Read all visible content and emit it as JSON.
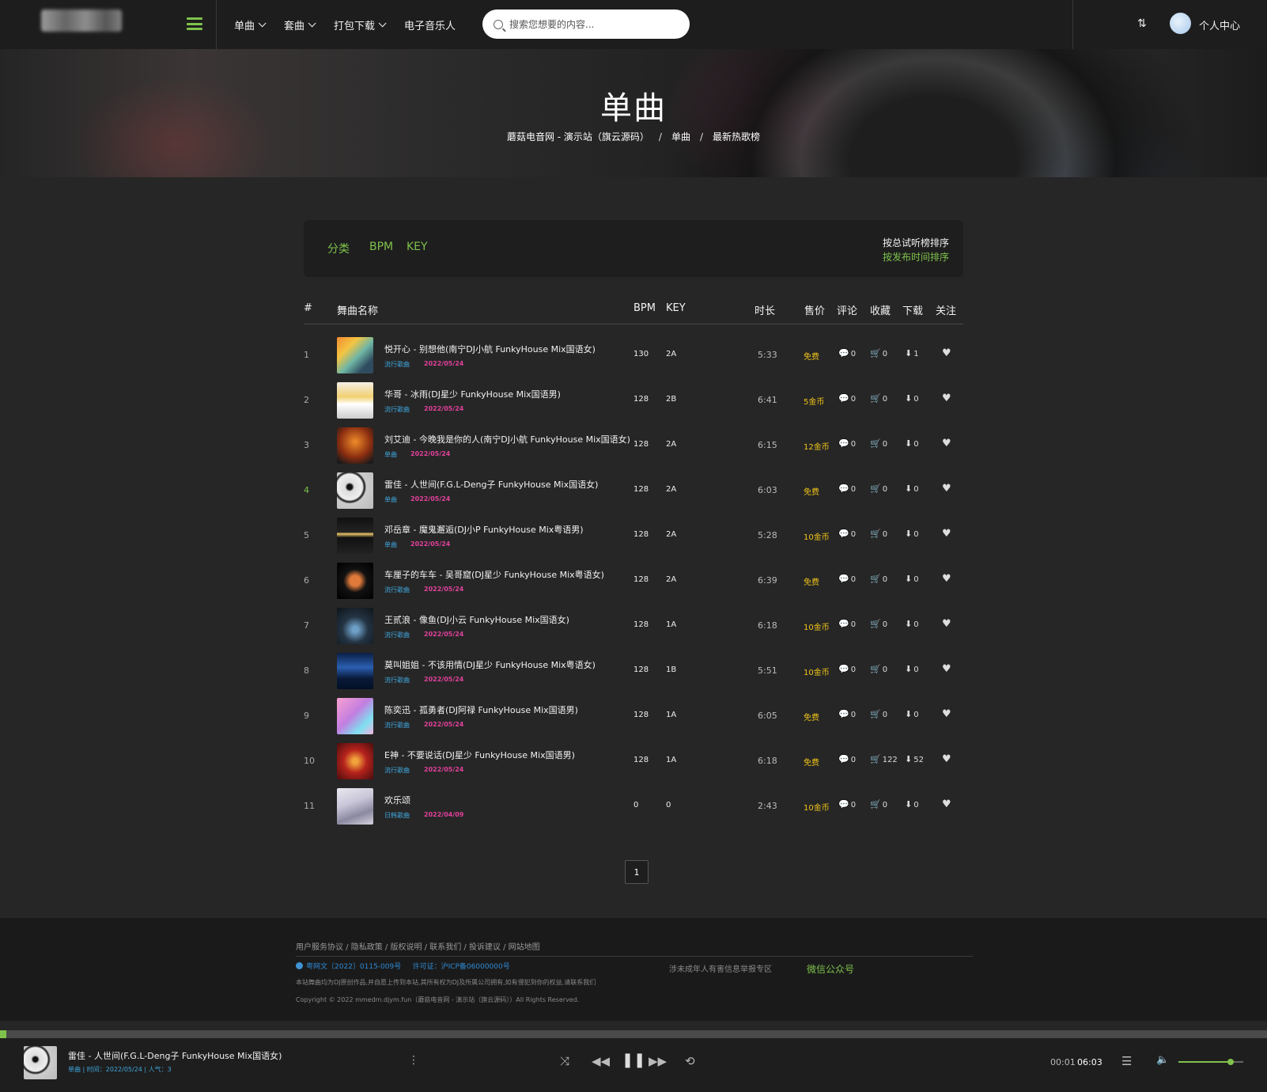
{
  "header": {
    "nav": [
      {
        "label": "单曲",
        "dropdown": true
      },
      {
        "label": "套曲",
        "dropdown": true
      },
      {
        "label": "打包下载",
        "dropdown": true
      },
      {
        "label": "电子音乐人",
        "dropdown": false
      }
    ],
    "search_placeholder": "搜索您想要的内容...",
    "user_center": "个人中心"
  },
  "banner": {
    "title": "单曲",
    "breadcrumb": [
      "蘑菇电音网 - 演示站（旗云源码）",
      "单曲",
      "最新热歌榜"
    ]
  },
  "filter": {
    "tabs": [
      "分类",
      "BPM",
      "KEY"
    ],
    "sort_primary": "按总试听榜排序",
    "sort_secondary": "按发布时间排序"
  },
  "table": {
    "headers": {
      "index": "#",
      "name": "舞曲名称",
      "bpm": "BPM",
      "key": "KEY",
      "duration": "时长",
      "price": "售价",
      "comments": "评论",
      "favorites": "收藏",
      "downloads": "下载",
      "follow": "关注"
    },
    "rows": [
      {
        "index": "1",
        "title": "悦开心 - 别想他(南宁DJ小航 FunkyHouse Mix国语女)",
        "category": "流行歌曲",
        "date": "2022/05/24",
        "bpm": "130",
        "key": "2A",
        "duration": "5:33",
        "price": "免费",
        "comments": "0",
        "favorites": "0",
        "downloads": "1"
      },
      {
        "index": "2",
        "title": "华哥 - 冰雨(DJ星少 FunkyHouse Mix国语男)",
        "category": "流行歌曲",
        "date": "2022/05/24",
        "bpm": "128",
        "key": "2B",
        "duration": "6:41",
        "price": "5金币",
        "comments": "0",
        "favorites": "0",
        "downloads": "0"
      },
      {
        "index": "3",
        "title": "刘艾迪 - 今晚我是你的人(南宁DJ小航 FunkyHouse Mix国语女)",
        "category": "单曲",
        "date": "2022/05/24",
        "bpm": "128",
        "key": "2A",
        "duration": "6:15",
        "price": "12金币",
        "comments": "0",
        "favorites": "0",
        "downloads": "0"
      },
      {
        "index": "4",
        "title": "雷佳 - 人世间(F.G.L-Deng子 FunkyHouse Mix国语女)",
        "category": "单曲",
        "date": "2022/05/24",
        "bpm": "128",
        "key": "2A",
        "duration": "6:03",
        "price": "免费",
        "comments": "0",
        "favorites": "0",
        "downloads": "0"
      },
      {
        "index": "5",
        "title": "邓岳章 - 魔鬼邂逅(DJ小P FunkyHouse Mix粤语男)",
        "category": "单曲",
        "date": "2022/05/24",
        "bpm": "128",
        "key": "2A",
        "duration": "5:28",
        "price": "10金币",
        "comments": "0",
        "favorites": "0",
        "downloads": "0"
      },
      {
        "index": "6",
        "title": "车厘子的车车 - 吴哥窟(DJ星少 FunkyHouse Mix粤语女)",
        "category": "流行歌曲",
        "date": "2022/05/24",
        "bpm": "128",
        "key": "2A",
        "duration": "6:39",
        "price": "免费",
        "comments": "0",
        "favorites": "0",
        "downloads": "0"
      },
      {
        "index": "7",
        "title": "王贰浪 - 像鱼(DJ小云 FunkyHouse Mix国语女)",
        "category": "流行歌曲",
        "date": "2022/05/24",
        "bpm": "128",
        "key": "1A",
        "duration": "6:18",
        "price": "10金币",
        "comments": "0",
        "favorites": "0",
        "downloads": "0"
      },
      {
        "index": "8",
        "title": "莫叫姐姐 - 不该用情(DJ星少 FunkyHouse Mix粤语女)",
        "category": "流行歌曲",
        "date": "2022/05/24",
        "bpm": "128",
        "key": "1B",
        "duration": "5:51",
        "price": "10金币",
        "comments": "0",
        "favorites": "0",
        "downloads": "0"
      },
      {
        "index": "9",
        "title": "陈奕迅 - 孤勇者(DJ阿禄 FunkyHouse Mix国语男)",
        "category": "流行歌曲",
        "date": "2022/05/24",
        "bpm": "128",
        "key": "1A",
        "duration": "6:05",
        "price": "免费",
        "comments": "0",
        "favorites": "0",
        "downloads": "0"
      },
      {
        "index": "10",
        "title": "E神 - 不要说话(DJ星少 FunkyHouse Mix国语男)",
        "category": "流行歌曲",
        "date": "2022/05/24",
        "bpm": "128",
        "key": "1A",
        "duration": "6:18",
        "price": "免费",
        "comments": "0",
        "favorites": "122",
        "downloads": "52"
      },
      {
        "index": "11",
        "title": "欢乐颂",
        "category": "日韩歌曲",
        "date": "2022/04/09",
        "bpm": "0",
        "key": "0",
        "duration": "2:43",
        "price": "10金币",
        "comments": "0",
        "favorites": "0",
        "downloads": "0"
      }
    ],
    "active_index": 4
  },
  "pagination": {
    "current": "1"
  },
  "footer": {
    "links": [
      "用户服务协议",
      "隐私政策",
      "版权说明",
      "联系我们",
      "投诉建议",
      "网站地图"
    ],
    "icp": "粤网文〔2022〕0115-009号",
    "license": "许可证：沪ICP备06000000号",
    "minor_report": "涉未成年人有害信息举报专区",
    "wechat": "微信公众号",
    "disclaimer": "本站舞曲均为DJ原创作品,并自愿上传到本站,其所有权为DJ及所属公司拥有,如有侵犯到你的权益,请联系我们",
    "copyright": "Copyright © 2022 mmedm.djym.fun（蘑菇电音网 - 演示站（旗云源码））All Rights Reserved."
  },
  "player": {
    "title": "雷佳 - 人世间(F.G.L-Deng子 FunkyHouse Mix国语女)",
    "meta": "单曲 | 时间：2022/05/24 | 人气：3",
    "current_time": "00:01",
    "total_time": "06:03",
    "progress_percent": 0.5,
    "volume_percent": 80
  },
  "colors": {
    "accent": "#7ec24b",
    "price": "#f0c419",
    "category": "#3fa6dd",
    "date": "#e0409a"
  },
  "icons": [
    "menu-icon",
    "chevron-down-icon",
    "search-icon",
    "equalizer-icon",
    "comment-icon",
    "cart-icon",
    "download-icon",
    "heart-icon",
    "more-icon",
    "shuffle-icon",
    "previous-icon",
    "pause-icon",
    "next-icon",
    "repeat-icon",
    "playlist-icon",
    "volume-icon"
  ]
}
